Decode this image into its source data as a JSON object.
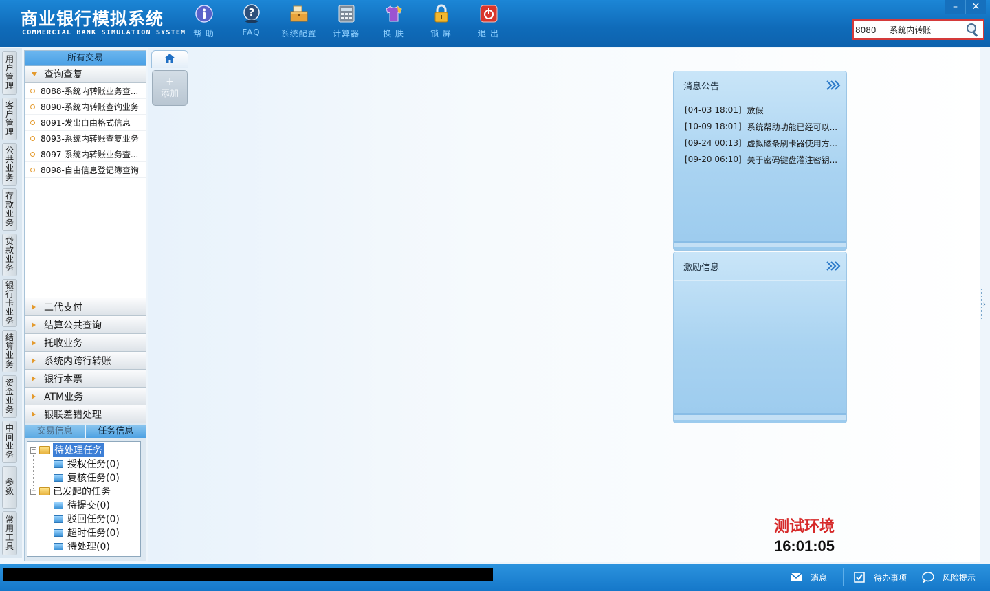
{
  "header": {
    "logo_cn": "商业银行模拟系统",
    "logo_en": "COMMERCIAL BANK SIMULATION SYSTEM",
    "toolbar": [
      {
        "label": "帮 助",
        "icon": "info-icon"
      },
      {
        "label": "FAQ",
        "icon": "question-icon"
      },
      {
        "label": "系统配置",
        "icon": "toolbox-icon"
      },
      {
        "label": "计算器",
        "icon": "calculator-icon"
      },
      {
        "label": "换 肤",
        "icon": "shirt-icon"
      },
      {
        "label": "锁 屏",
        "icon": "lock-icon"
      },
      {
        "label": "退 出",
        "icon": "power-icon"
      }
    ],
    "search_value": "8080 － 系统内转账",
    "window_controls": [
      "–",
      "✕"
    ]
  },
  "vtabs": [
    "用户管理",
    "客户管理",
    "公共业务",
    "存款业务",
    "贷款业务",
    "银行卡业务",
    "结算业务",
    "资金业务",
    "中间业务",
    "参数",
    "常用工具"
  ],
  "nav": {
    "title": "所有交易",
    "open_group": "查询查复",
    "items": [
      "8088-系统内转账业务查...",
      "8090-系统内转账查询业务",
      "8091-发出自由格式信息",
      "8093-系统内转账查复业务",
      "8097-系统内转账业务查...",
      "8098-自由信息登记簿查询"
    ],
    "groups": [
      "二代支付",
      "结算公共查询",
      "托收业务",
      "系统内跨行转账",
      "银行本票",
      "ATM业务",
      "银联差错处理"
    ],
    "tabs": {
      "inactive": "交易信息",
      "active": "任务信息"
    },
    "tree": {
      "pending": "待处理任务",
      "pending_children": [
        "授权任务(0)",
        "复核任务(0)"
      ],
      "initiated": "已发起的任务",
      "initiated_children": [
        "待提交(0)",
        "驳回任务(0)",
        "超时任务(0)",
        "待处理(0)"
      ]
    }
  },
  "main": {
    "add_plus": "+",
    "add_label": "添加",
    "notices_title": "消息公告",
    "notices": [
      {
        "date": "[04-03 18:01]",
        "text": "放假"
      },
      {
        "date": "[10-09 18:01]",
        "text": "系统帮助功能已经可以..."
      },
      {
        "date": "[09-24 00:13]",
        "text": "虚拟磁条刷卡器使用方..."
      },
      {
        "date": "[09-20 06:10]",
        "text": "关于密码键盘灌注密钥..."
      }
    ],
    "incentive_title": "激励信息",
    "env_label": "测试环境",
    "clock": "16:01:05",
    "edge_arrow": "›"
  },
  "statusbar": {
    "message": "消息",
    "todo": "待办事项",
    "risk": "风险提示"
  },
  "colors": {
    "header_blue": "#0f6bb9",
    "accent_orange": "#e49a2d",
    "env_red": "#d62a2a",
    "search_border": "#d43a3a"
  }
}
